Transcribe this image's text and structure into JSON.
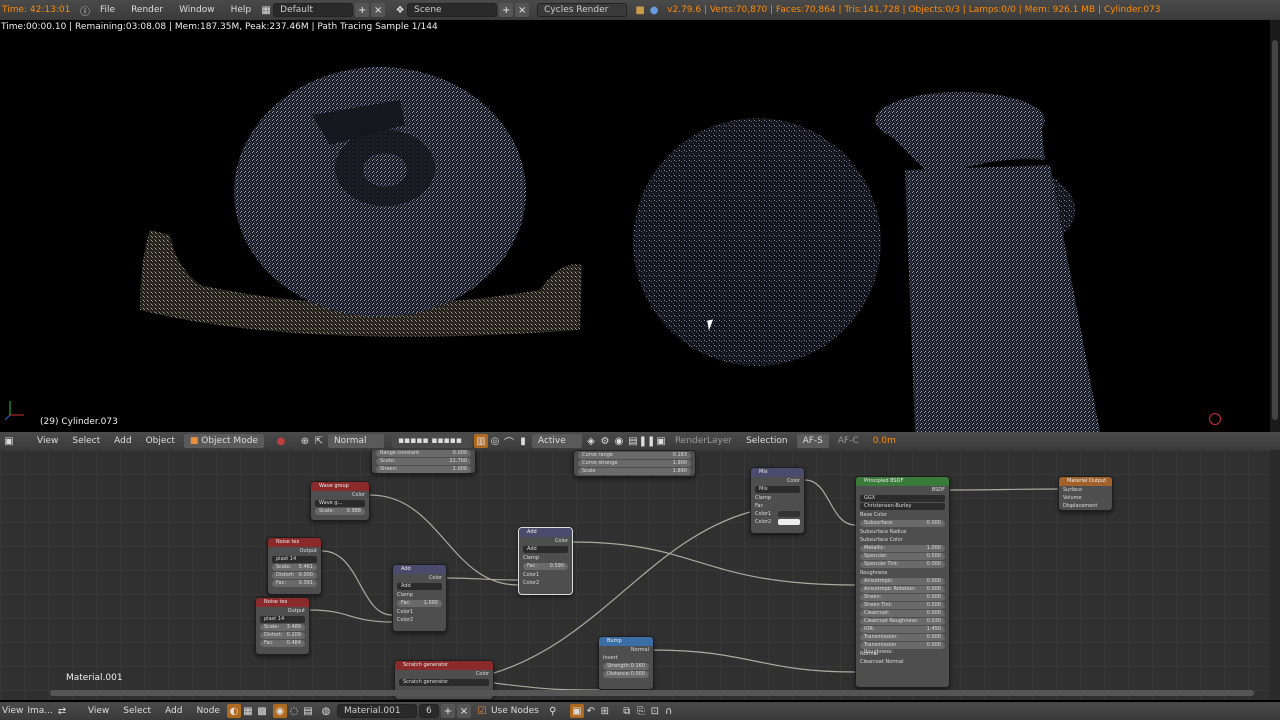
{
  "topbar": {
    "time": "Time: 42:13:01",
    "menus": [
      "File",
      "Render",
      "Window",
      "Help"
    ],
    "layout": "Default",
    "scene": "Scene",
    "engine": "Cycles Render",
    "stats": "v2.79.6 | Verts:70,870 | Faces:70,864 | Tris:141,728 | Objects:0/3 | Lamps:0/0 | Mem: 926.1 MB | Cylinder.073"
  },
  "viewport": {
    "render_info": "Time:00:00.10 | Remaining:03:08.08 | Mem:187.35M, Peak:237.46M | Path Tracing Sample 1/144",
    "object_label": "(29) Cylinder.073"
  },
  "view_header": {
    "view": "View",
    "select": "Select",
    "add": "Add",
    "object": "Object",
    "mode": "Object Mode",
    "pivot": "Normal",
    "active": "Active",
    "renderlayer": "RenderLayer",
    "selection": "Selection",
    "afs": "AF-S",
    "afc": "AF-C",
    "distance": "0.0m"
  },
  "nodes": {
    "wave": {
      "title": "Wave group",
      "out": "Color",
      "p1": "Wave g...",
      "scale_l": "Scale:",
      "scale_v": "0.988"
    },
    "noise1": {
      "title": "Noise tex",
      "out": "Output",
      "p1": "plast",
      "p1v": "14",
      "scale_l": "Scale:",
      "scale_v": "5.461",
      "dist_l": "Distort:",
      "dist_v": "0.000",
      "fac_l": "Fac:",
      "fac_v": "0.391"
    },
    "noise2": {
      "title": "Noise tex",
      "out": "Output",
      "p1": "plast",
      "p1v": "14",
      "scale_l": "Scale:",
      "scale_v": "3.489",
      "dist_l": "Distort:",
      "dist_v": "0.209",
      "fac_l": "Fac:",
      "fac_v": "0.484"
    },
    "topmid": {
      "r1": "Range constant",
      "r1v": "0.000",
      "r2": "Scale:",
      "r2v": "21.700",
      "r3": "Sheen:",
      "r3v": "1.000"
    },
    "add1": {
      "title": "Add",
      "out": "Color",
      "mode": "Add",
      "clamp": "Clamp",
      "fac_l": "Fac:",
      "fac_v": "1.000",
      "c1": "Color1",
      "c2": "Color2"
    },
    "add2": {
      "title": "Add",
      "out": "Color",
      "mode": "Add",
      "clamp": "Clamp",
      "fac_l": "Fac:",
      "fac_v": "0.590",
      "c1": "Color1",
      "c2": "Color2"
    },
    "curve": {
      "r1": "Curve range",
      "r1v": "0.183",
      "r2": "Curve strange",
      "r2v": "1.900",
      "r3": "Scale",
      "r3v": "1.890"
    },
    "mix": {
      "title": "Mix",
      "out": "Color",
      "mode": "Mix",
      "clamp": "Clamp",
      "fac": "Fac",
      "c1": "Color1",
      "c2": "Color2"
    },
    "scratch": {
      "title": "Scratch generator",
      "out": "Color",
      "p1": "Scratch generator"
    },
    "bump": {
      "title": "Bump",
      "out": "Normal",
      "inv": "Invert",
      "s_l": "Strength:",
      "s_v": "0.160",
      "d_l": "Distance:",
      "d_v": "0.000"
    },
    "principled": {
      "title": "Principled BSDF",
      "out": "BSDF",
      "dist": "GGX",
      "sss": "Christensen-Burley",
      "rows": [
        {
          "l": "Base Color",
          "v": ""
        },
        {
          "l": "Subsurface:",
          "v": "0.000"
        },
        {
          "l": "Subsurface Radius",
          "v": ""
        },
        {
          "l": "Subsurface Color",
          "v": ""
        },
        {
          "l": "Metallic:",
          "v": "1.000"
        },
        {
          "l": "Specular:",
          "v": "0.500"
        },
        {
          "l": "Specular Tint:",
          "v": "0.000"
        },
        {
          "l": "Roughness",
          "v": ""
        },
        {
          "l": "Anisotropic:",
          "v": "0.000"
        },
        {
          "l": "Anisotropic Rotation:",
          "v": "0.000"
        },
        {
          "l": "Sheen:",
          "v": "0.000"
        },
        {
          "l": "Sheen Tint:",
          "v": "0.500"
        },
        {
          "l": "Clearcoat:",
          "v": "0.000"
        },
        {
          "l": "Clearcoat Roughness:",
          "v": "0.030"
        },
        {
          "l": "IOR:",
          "v": "1.450"
        },
        {
          "l": "Transmission:",
          "v": "0.000"
        },
        {
          "l": "Transmission Roughness:",
          "v": "0.000"
        },
        {
          "l": "Normal",
          "v": ""
        },
        {
          "l": "Clearcoat Normal",
          "v": ""
        }
      ]
    },
    "output": {
      "title": "Material Output",
      "s1": "Surface",
      "s2": "Volume",
      "s3": "Displacement"
    }
  },
  "material_label": "Material.001",
  "bottombar": {
    "view": "View",
    "select": "Select",
    "add": "Add",
    "node": "Node",
    "material": "Material.001",
    "users": "6",
    "use_nodes": "Use Nodes",
    "left1": "View",
    "left2": "Ima..."
  }
}
